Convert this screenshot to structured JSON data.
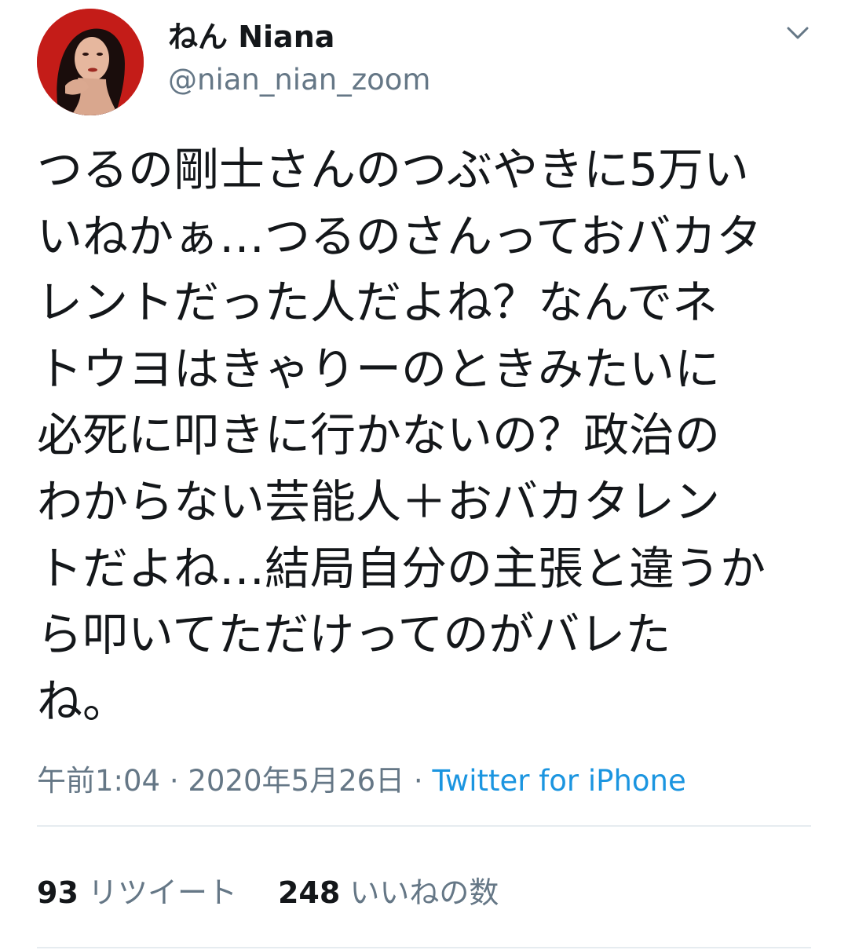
{
  "author": {
    "display_name": "ねん Niana",
    "handle": "@nian_nian_zoom"
  },
  "tweet": {
    "text": "つるの剛士さんのつぶやきに5万い\nいねかぁ…つるのさんっておバカタ\nレントだった人だよね？なんでネ\nトウヨはきゃりーのときみたいに\n必死に叩きに行かないの？政治の\nわからない芸能人＋おバカタレン\nトだよね…結局自分の主張と違うか\nら叩いてただけってのがバレた\nね。",
    "timestamp": "午前1:04 · 2020年5月26日 ",
    "separator": "· ",
    "source": "Twitter for iPhone"
  },
  "stats": {
    "retweets_count": "93",
    "retweets_label": " リツイート",
    "likes_count": "248",
    "likes_label": " いいねの数"
  },
  "icons": {
    "avatar": "profile-photo",
    "menu": "chevron-down-icon"
  },
  "colors": {
    "text": "#14171a",
    "secondary": "#657786",
    "link": "#1b95e0",
    "divider": "#e6ecf0",
    "avatar_bg": "#c8201c"
  }
}
